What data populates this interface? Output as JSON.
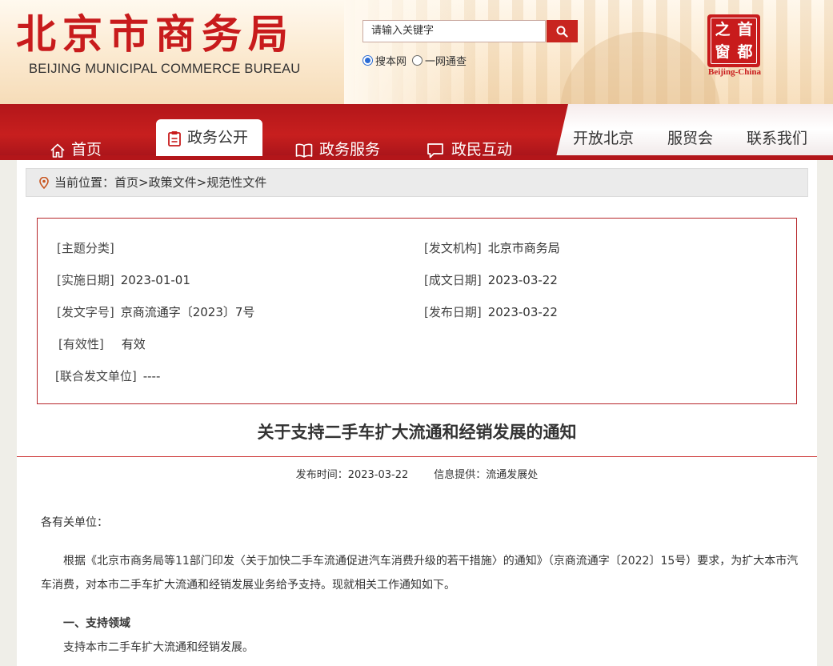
{
  "header": {
    "logo_cn": "北京市商务局",
    "logo_en": "BEIJING MUNICIPAL COMMERCE BUREAU",
    "search_placeholder": "请输入关键字",
    "scope_options": [
      "搜本网",
      "一网通查"
    ],
    "capital_logo_glyphs": [
      "之",
      "首",
      "窗",
      "都"
    ],
    "capital_logo_caption": "Beijing-China",
    "colors": {
      "brand_red": "#c81b1c",
      "nav_red": "#b3161a"
    }
  },
  "nav": {
    "items": [
      {
        "label": "首页",
        "icon": "home-icon"
      },
      {
        "label": "政务公开",
        "icon": "clipboard-icon",
        "active": true
      },
      {
        "label": "政务服务",
        "icon": "book-icon"
      },
      {
        "label": "政民互动",
        "icon": "chat-icon"
      }
    ],
    "right_items": [
      "开放北京",
      "服贸会",
      "联系我们"
    ]
  },
  "breadcrumb": {
    "prefix": "当前位置：",
    "items": [
      "首页",
      "政策文件",
      "规范性文件"
    ],
    "separator": ">"
  },
  "meta": {
    "topic": {
      "label": "[主题分类]",
      "value": ""
    },
    "issuer": {
      "label": "[发文机构]",
      "value": "北京市商务局"
    },
    "effective_date": {
      "label": "[实施日期]",
      "value": "2023-01-01"
    },
    "written_date": {
      "label": "[成文日期]",
      "value": "2023-03-22"
    },
    "doc_no": {
      "label": "[发文字号]",
      "value": "京商流通字〔2023〕7号"
    },
    "publish_date": {
      "label": "[发布日期]",
      "value": "2023-03-22"
    },
    "validity": {
      "label": "[有效性]",
      "value": "有效"
    },
    "joint_units": {
      "label": "[联合发文单位]",
      "value": "----"
    }
  },
  "article": {
    "title": "关于支持二手车扩大流通和经销发展的通知",
    "pub_time": "发布时间：2023-03-22",
    "info_source": "信息提供：流通发展处",
    "salutation": "各有关单位：",
    "para1_line1": "根据《北京市商务局等11部门印发〈关于加快二手车流通促进汽车消费升级的若干措施〉的通知》（京商流通字〔2022〕15号）要求，为扩大本市汽",
    "para1_line2": "车消费，对本市二手车扩大流通和经销发展业务给予支持。现就相关工作通知如下。",
    "section1_title": "一、支持领域",
    "section1_text": "支持本市二手车扩大流通和经销发展。"
  }
}
